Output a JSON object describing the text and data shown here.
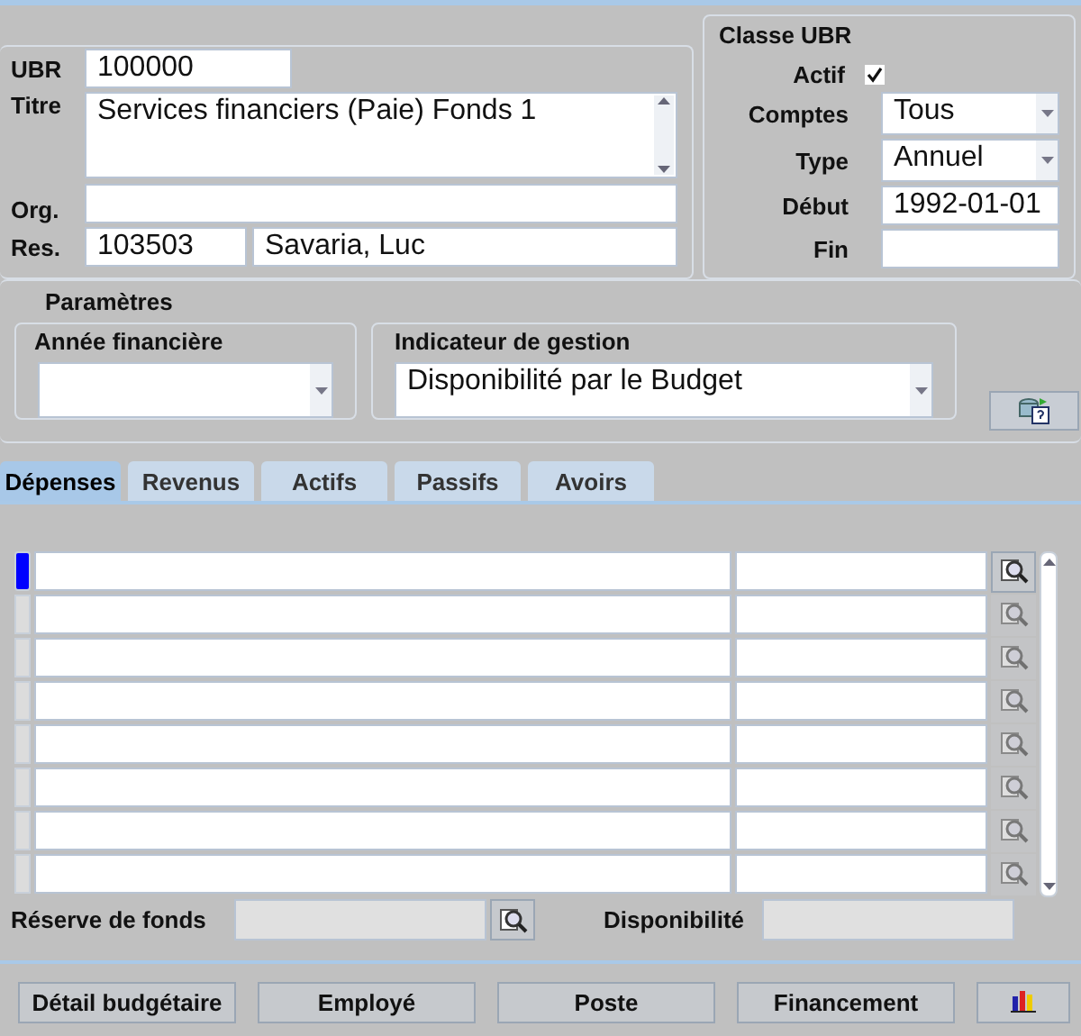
{
  "ubr": {
    "label": "UBR",
    "value": "100000"
  },
  "titre": {
    "label": "Titre",
    "value": "Services financiers (Paie) Fonds 1"
  },
  "org": {
    "label": "Org."
  },
  "res": {
    "label": "Res.",
    "code": "103503",
    "name": "Savaria, Luc"
  },
  "classe": {
    "title": "Classe UBR",
    "actif": {
      "label": "Actif",
      "checked": true
    },
    "comptes": {
      "label": "Comptes",
      "value": "Tous"
    },
    "type": {
      "label": "Type",
      "value": "Annuel"
    },
    "debut": {
      "label": "Début",
      "value": "1992-01-01"
    },
    "fin": {
      "label": "Fin"
    }
  },
  "parametres": {
    "title": "Paramètres",
    "annee": {
      "label": "Année financière"
    },
    "indicateur": {
      "label": "Indicateur de gestion",
      "value": "Disponibilité par le Budget"
    }
  },
  "tabs": [
    {
      "label": "Dépenses",
      "selected": true
    },
    {
      "label": "Revenus",
      "selected": false
    },
    {
      "label": "Actifs",
      "selected": false
    },
    {
      "label": "Passifs",
      "selected": false
    },
    {
      "label": "Avoirs",
      "selected": false
    }
  ],
  "rows": [
    {
      "selected": true
    },
    {
      "selected": false
    },
    {
      "selected": false
    },
    {
      "selected": false
    },
    {
      "selected": false
    },
    {
      "selected": false
    },
    {
      "selected": false
    },
    {
      "selected": false
    }
  ],
  "reserve": {
    "label": "Réserve de fonds"
  },
  "disponibilite": {
    "label": "Disponibilité"
  },
  "buttons": [
    "Détail budgétaire",
    "Employé",
    "Poste",
    "Financement"
  ]
}
